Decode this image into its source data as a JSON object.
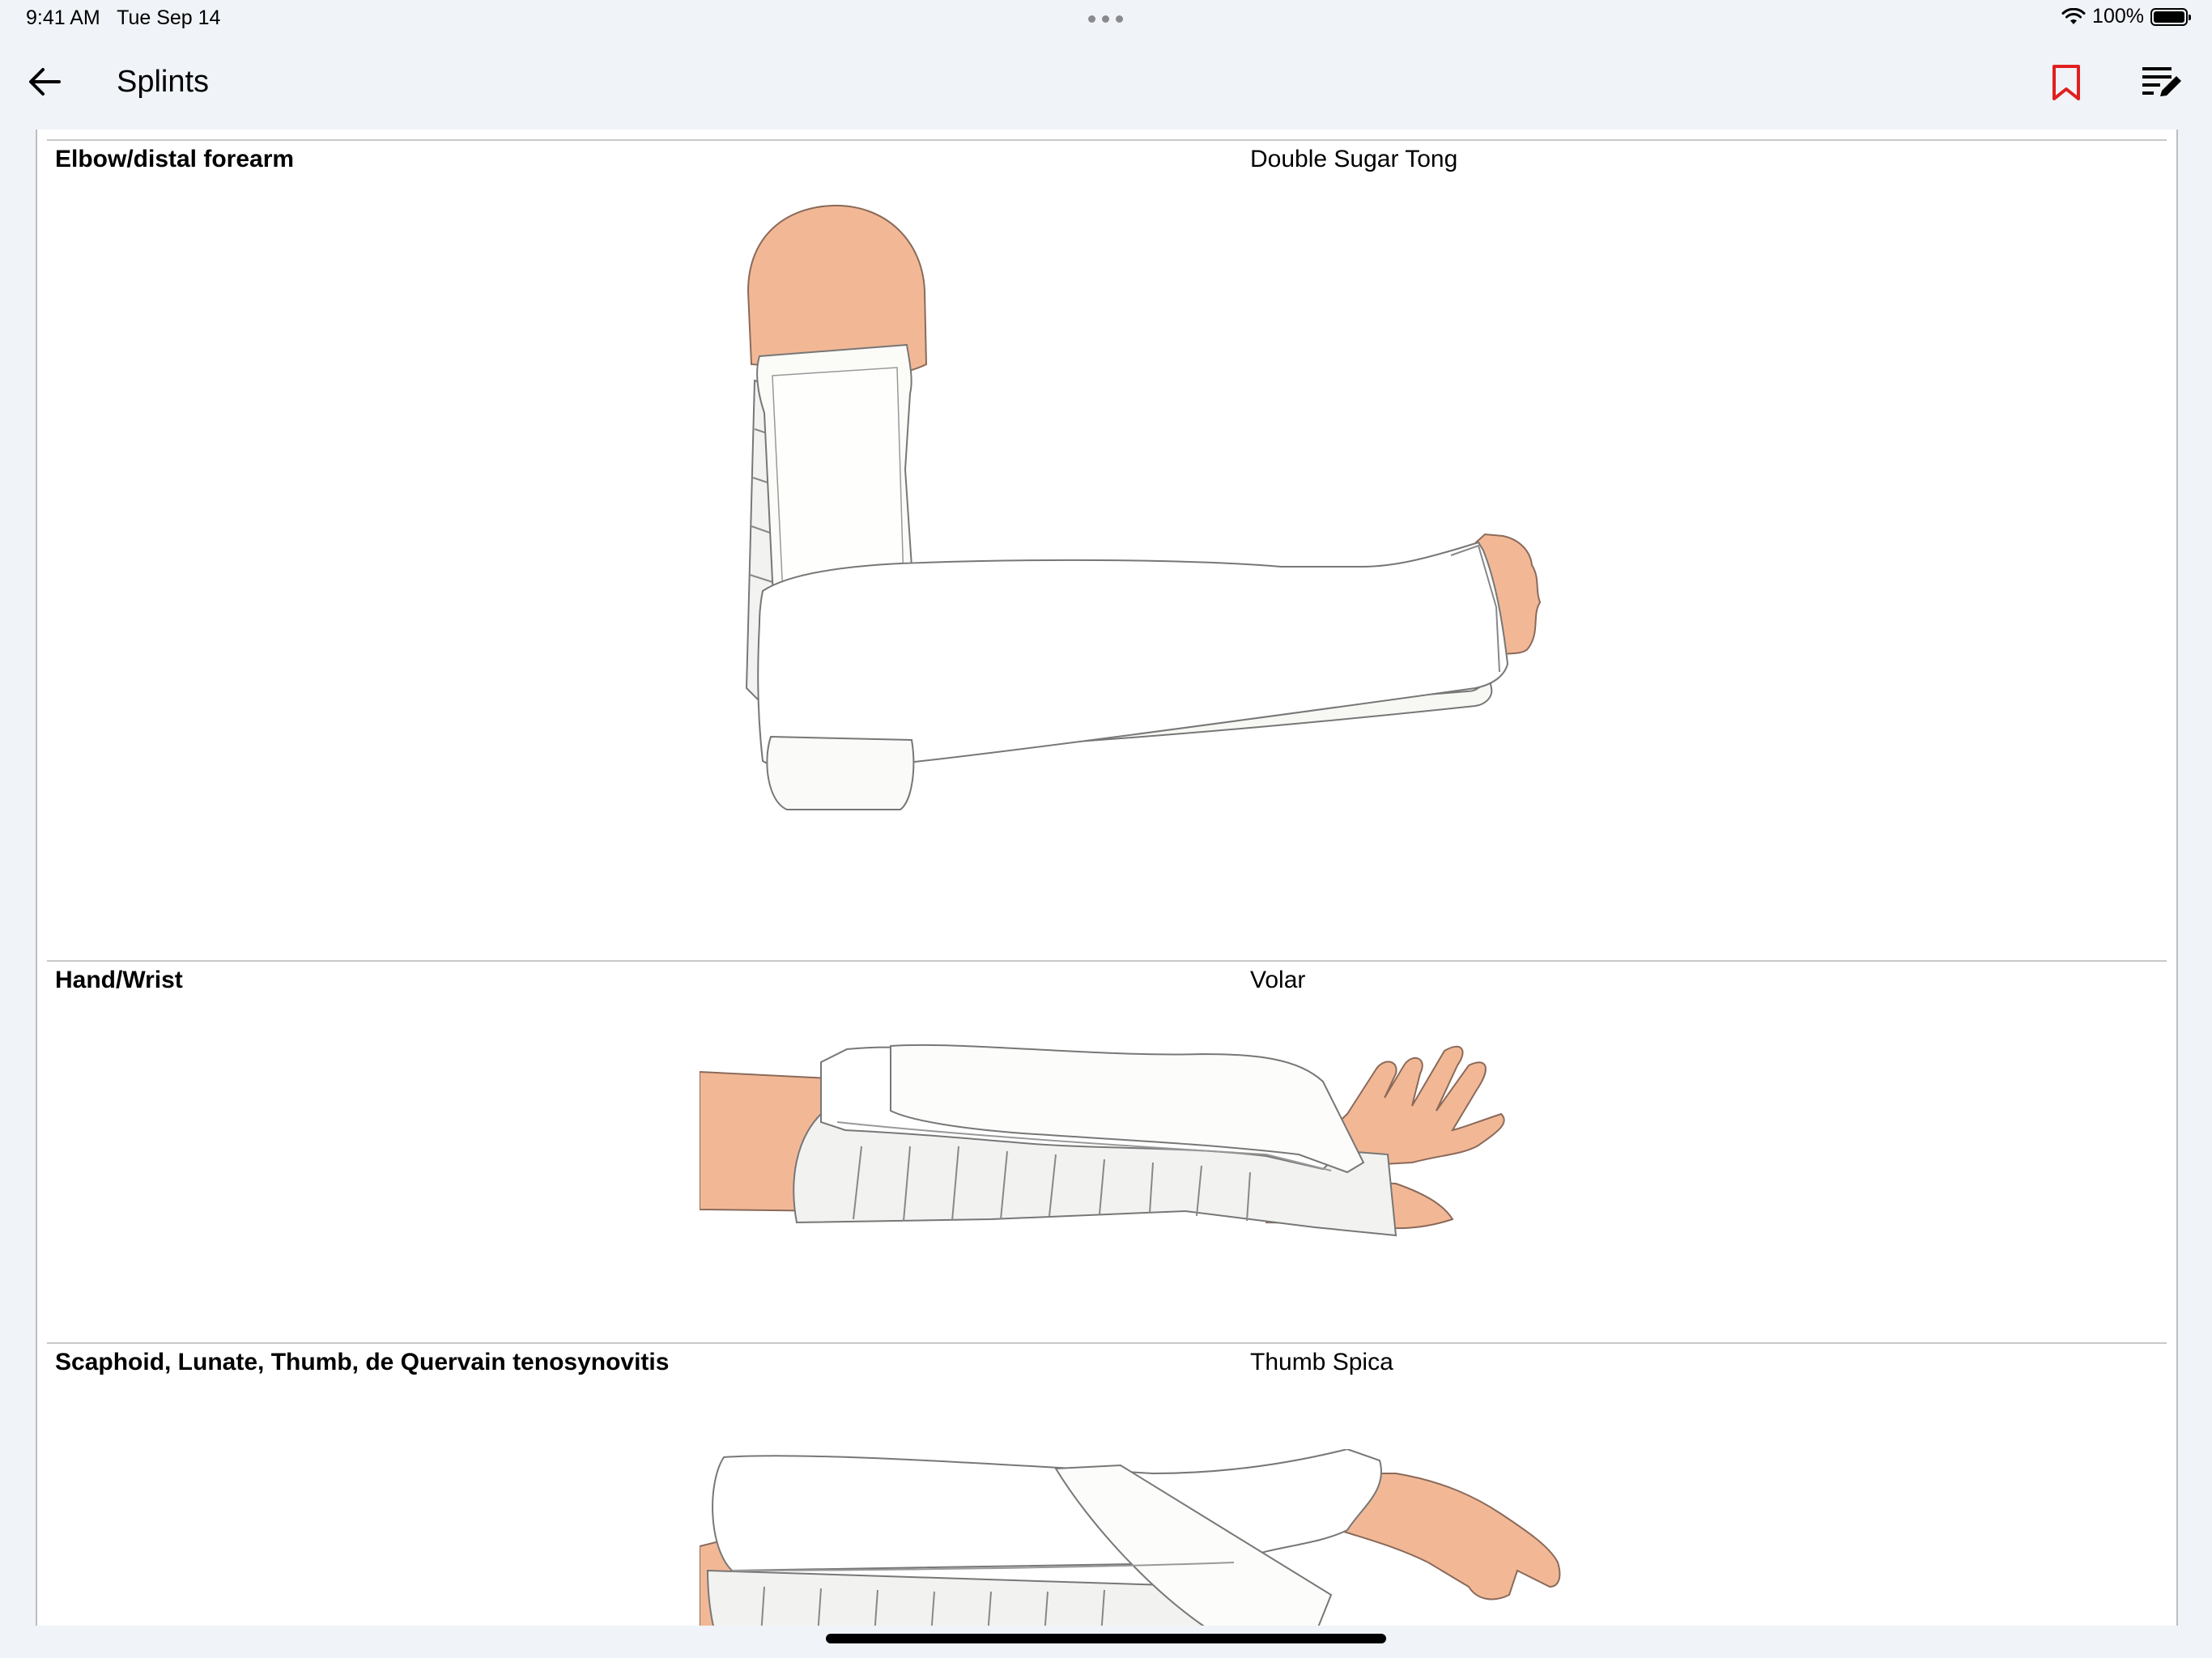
{
  "status_bar": {
    "time": "9:41 AM",
    "date": "Tue Sep 14",
    "battery": "100%"
  },
  "nav": {
    "title": "Splints"
  },
  "colors": {
    "accent": "#e0201f",
    "skin": "#f2b896",
    "splint": "#ffffff"
  },
  "rows": [
    {
      "region": "Elbow/distal forearm",
      "splint": "Double Sugar Tong"
    },
    {
      "region": "Hand/Wrist",
      "splint": "Volar"
    },
    {
      "region": "Scaphoid, Lunate, Thumb, de Quervain tenosynovitis",
      "splint": "Thumb Spica"
    }
  ]
}
